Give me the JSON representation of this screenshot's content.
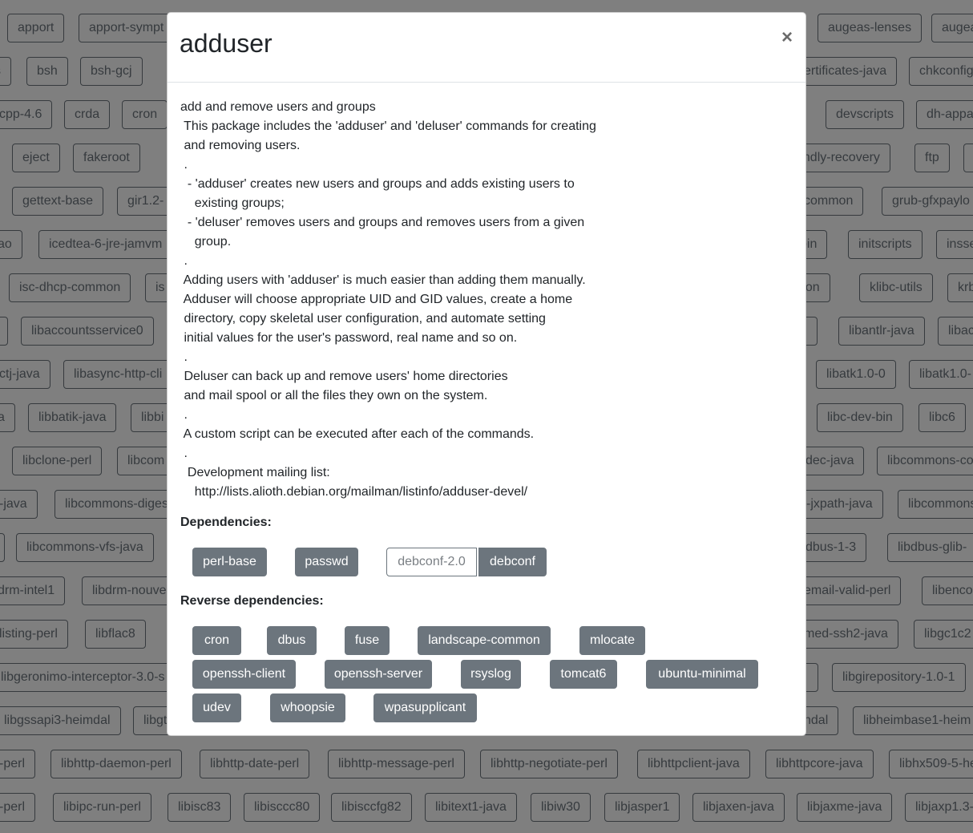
{
  "background_packages": [
    [
      "apport",
      "apport-sympt",
      "augeas-lenses",
      "augea"
    ],
    [
      "s",
      "bsh",
      "bsh-gcj",
      "ertificates-java",
      "chkconfig"
    ],
    [
      "cpp-4.6",
      "crda",
      "cron",
      "devscripts",
      "dh-appa"
    ],
    [
      "eject",
      "fakeroot",
      "endly-recovery",
      "ftp",
      ""
    ],
    [
      "gettext-base",
      "gir1.2-",
      "common",
      "grub-gfxpaylo"
    ],
    [
      "ao",
      "icedtea-6-jre-jamvm",
      "bin",
      "initscripts",
      "insse"
    ],
    [
      "isc-dhcp-common",
      "is",
      "ation",
      "klibc-utils",
      "krb"
    ],
    [
      "",
      "libaccountsservice0",
      "rl",
      "libantlr-java",
      "libac"
    ],
    [
      "ctj-java",
      "libasync-http-cli",
      "libatk1.0-0",
      "libatk1.0-"
    ],
    [
      "a",
      "libbatik-java",
      "libbi",
      "libc-dev-bin",
      "libc6"
    ],
    [
      "libclone-perl",
      "libcom",
      "dec-java",
      "libcommons-co"
    ],
    [
      "-java",
      "libcommons-diges",
      "-jxpath-java",
      "libcommons"
    ],
    [
      "",
      "libcommons-vfs-java",
      "dbus-1-3",
      "libdbus-glib-"
    ],
    [
      "drm-intel1",
      "libdrm-nouve",
      "email-valid-perl",
      "libenco"
    ],
    [
      "listing-perl",
      "libflac8",
      "med-ssh2-java",
      "libgc1c2"
    ],
    [
      "libgeronimo-interceptor-3.0-s",
      "",
      "libgirepository-1.0-1"
    ],
    [
      "libgssapi3-heimdal",
      "libgt",
      "ndal",
      "libheimbase1-heim"
    ],
    [
      "-perl",
      "libhttp-daemon-perl",
      "libhttp-date-perl",
      "libhttp-message-perl",
      "libhttp-negotiate-perl",
      "libhttpclient-java",
      "libhttpcore-java",
      "libhx509-5-he"
    ],
    [
      "-perl",
      "libipc-run-perl",
      "libisc83",
      "libisccc80",
      "libisccfg82",
      "libitext1-java",
      "libiw30",
      "libjasper1",
      "libjaxen-java",
      "libjaxme-java",
      "libjaxp1.3-"
    ]
  ],
  "modal": {
    "title": "adduser",
    "close_label": "×",
    "description": "add and remove users and groups\n This package includes the 'adduser' and 'deluser' commands for creating\n and removing users.\n .\n  - 'adduser' creates new users and groups and adds existing users to\n    existing groups;\n  - 'deluser' removes users and groups and removes users from a given\n    group.\n .\n Adding users with 'adduser' is much easier than adding them manually.\n Adduser will choose appropriate UID and GID values, create a home\n directory, copy skeletal user configuration, and automate setting\n initial values for the user's password, real name and so on.\n .\n Deluser can back up and remove users' home directories\n and mail spool or all the files they own on the system.\n .\n A custom script can be executed after each of the commands.\n .\n  Development mailing list:\n    http://lists.alioth.debian.org/mailman/listinfo/adduser-devel/",
    "dependencies_heading": "Dependencies:",
    "dependencies": [
      "perl-base",
      "passwd",
      "debconf-2.0",
      "debconf"
    ],
    "reverse_dependencies_heading": "Reverse dependencies:",
    "reverse_dependencies": [
      "cron",
      "dbus",
      "fuse",
      "landscape-common",
      "mlocate",
      "openssh-client",
      "openssh-server",
      "rsyslog",
      "tomcat6",
      "ubuntu-minimal",
      "udev",
      "whoopsie",
      "wpasupplicant"
    ]
  },
  "colors": {
    "chip_background": "#6c757d",
    "chip_text": "#ffffff",
    "backdrop": "rgba(0,0,0,0.5)"
  }
}
